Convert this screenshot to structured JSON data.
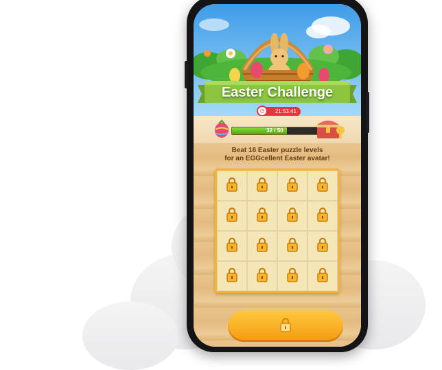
{
  "event": {
    "title": "Easter Challenge",
    "timer": "21:53:41",
    "progress": {
      "label": "32 / 50",
      "current": 32,
      "total": 50
    },
    "description_line1": "Beat 16 Easter puzzle levels",
    "description_line2": "for an EGGcellent Easter avatar!"
  },
  "puzzle": {
    "cells": [
      "locked",
      "locked",
      "locked",
      "locked",
      "locked",
      "locked",
      "locked",
      "locked",
      "locked",
      "locked",
      "locked",
      "locked",
      "locked",
      "locked",
      "locked",
      "locked"
    ]
  },
  "colors": {
    "banner_green": "#8cc63f",
    "timer_red": "#e6353d",
    "lock_gold": "#f2b533",
    "button_orange": "#f7a91e"
  },
  "icons": {
    "lock": "lock-icon",
    "clock": "clock-icon",
    "chest": "treasure-chest-icon",
    "egg": "easter-egg-icon"
  }
}
